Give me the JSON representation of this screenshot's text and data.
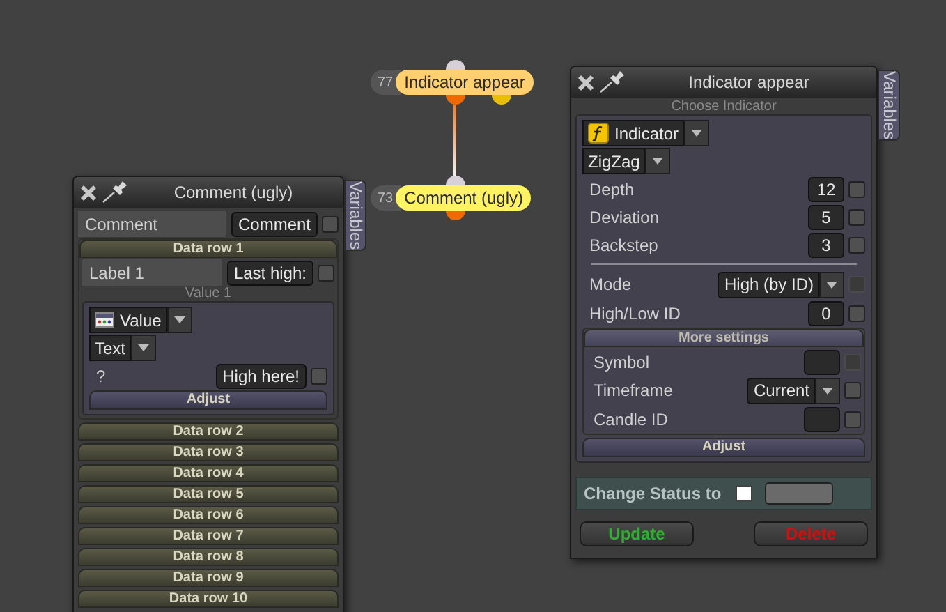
{
  "nodes": [
    {
      "number": "77",
      "label": "Indicator appear",
      "color": "#ffcf70",
      "extra_output": true
    },
    {
      "number": "73",
      "label": "Comment (ugly)",
      "color": "#fff263",
      "extra_output": false
    }
  ],
  "panels": [
    {
      "title": "Comment (ugly)",
      "side_tab": "Variables",
      "rows": [
        {
          "kind": "field",
          "label": "Comment",
          "value": "Comment",
          "checked": false,
          "disabled": false,
          "shaded": true
        },
        {
          "kind": "section",
          "title": "Data row 1",
          "expanded": true,
          "rows": [
            {
              "kind": "field",
              "label": "Label 1",
              "value": "Last high:",
              "checked": false,
              "disabled": false,
              "shaded": true
            },
            {
              "kind": "group",
              "caption": "Value 1",
              "rows": [
                {
                  "kind": "value_dropdown",
                  "value": "Value"
                },
                {
                  "kind": "dropdown",
                  "value": "Text"
                },
                {
                  "kind": "field",
                  "label": "?",
                  "value": "High here!",
                  "checked": false,
                  "disabled": false,
                  "shaded": false
                },
                {
                  "kind": "button",
                  "label": "Adjust"
                }
              ]
            }
          ]
        },
        {
          "kind": "section",
          "title": "Data row 2",
          "expanded": false
        },
        {
          "kind": "section",
          "title": "Data row 3",
          "expanded": false
        },
        {
          "kind": "section",
          "title": "Data row 4",
          "expanded": false
        },
        {
          "kind": "section",
          "title": "Data row 5",
          "expanded": false
        },
        {
          "kind": "section",
          "title": "Data row 6",
          "expanded": false
        },
        {
          "kind": "section",
          "title": "Data row 7",
          "expanded": false
        },
        {
          "kind": "section",
          "title": "Data row 8",
          "expanded": false
        },
        {
          "kind": "section",
          "title": "Data row 9",
          "expanded": false
        },
        {
          "kind": "section",
          "title": "Data row 10",
          "expanded": false
        }
      ]
    },
    {
      "title": "Indicator appear",
      "side_tab": "Variables",
      "rows": [
        {
          "kind": "group",
          "caption": "Choose Indicator",
          "rows": [
            {
              "kind": "function_dropdown",
              "value": "Indicator"
            },
            {
              "kind": "dropdown",
              "value": "ZigZag"
            },
            {
              "kind": "field",
              "label": "Depth",
              "value": "12",
              "checked": false,
              "disabled": false
            },
            {
              "kind": "field",
              "label": "Deviation",
              "value": "5",
              "checked": false,
              "disabled": false
            },
            {
              "kind": "field",
              "label": "Backstep",
              "value": "3",
              "checked": false,
              "disabled": false
            },
            {
              "kind": "divider"
            },
            {
              "kind": "select",
              "label": "Mode",
              "value": "High (by ID)",
              "checked": false,
              "disabled": true
            },
            {
              "kind": "field",
              "label": "High/Low ID",
              "value": "0",
              "checked": false,
              "disabled": false
            },
            {
              "kind": "section",
              "title": "More settings",
              "expanded": true,
              "rows": [
                {
                  "kind": "field",
                  "label": "Symbol",
                  "checked": false,
                  "disabled": true
                },
                {
                  "kind": "select",
                  "label": "Timeframe",
                  "value": "Current",
                  "checked": false,
                  "disabled": false
                },
                {
                  "kind": "field",
                  "label": "Candle ID",
                  "checked": false,
                  "disabled": false
                }
              ]
            },
            {
              "kind": "button",
              "label": "Adjust"
            }
          ]
        },
        {
          "kind": "status",
          "label": "Change Status to",
          "checked": false
        },
        {
          "kind": "actions",
          "buttons": [
            {
              "label": "Update",
              "kind": "confirm"
            },
            {
              "label": "Delete",
              "kind": "danger"
            }
          ]
        }
      ]
    }
  ]
}
